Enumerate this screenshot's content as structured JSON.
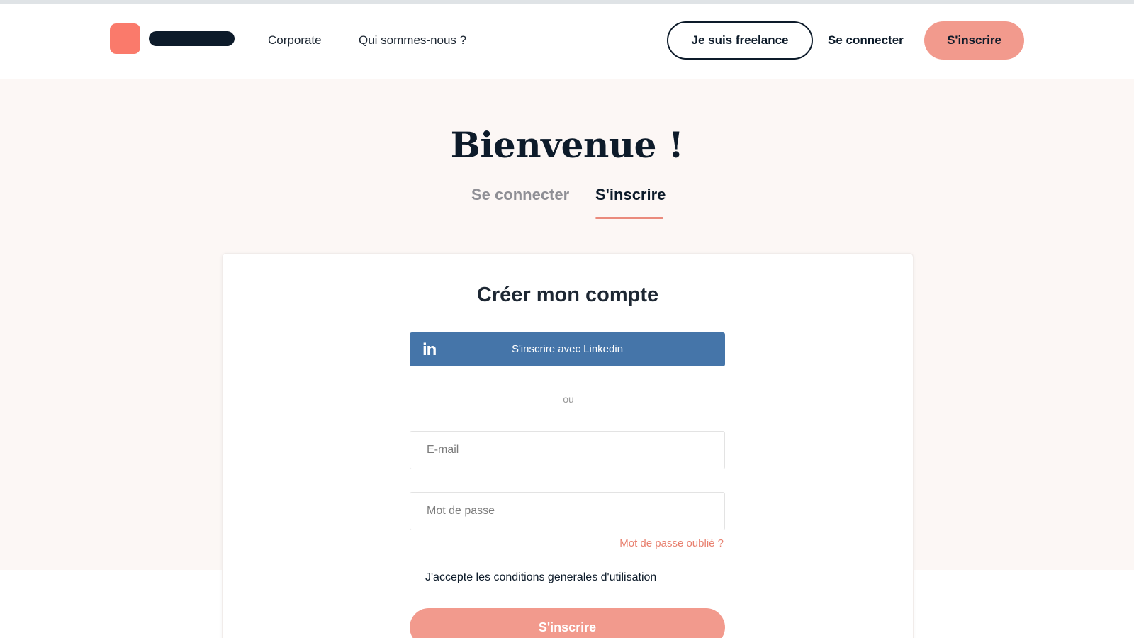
{
  "header": {
    "nav": {
      "corporate": "Corporate",
      "about": "Qui sommes-nous ?"
    },
    "freelance_button": "Je suis freelance",
    "login_link": "Se connecter",
    "signup_button": "S'inscrire"
  },
  "hero": {
    "title": "Bienvenue !",
    "tabs": {
      "login": "Se connecter",
      "signup": "S'inscrire"
    },
    "active_tab": "signup"
  },
  "form": {
    "title": "Créer mon compte",
    "linkedin_icon": "in",
    "linkedin_button": "S'inscrire avec Linkedin",
    "separator": "ou",
    "email_placeholder": "E-mail",
    "password_placeholder": "Mot de passe",
    "forgot_password": "Mot de passe oublié ?",
    "terms": "J'accepte les conditions generales d'utilisation",
    "submit": "S'inscrire"
  },
  "colors": {
    "brand_coral": "#fa7a6b",
    "button_salmon": "#f29a8d",
    "navy": "#0d1b2a",
    "linkedin_blue": "#4575a9",
    "hero_bg": "#fcf7f5"
  }
}
